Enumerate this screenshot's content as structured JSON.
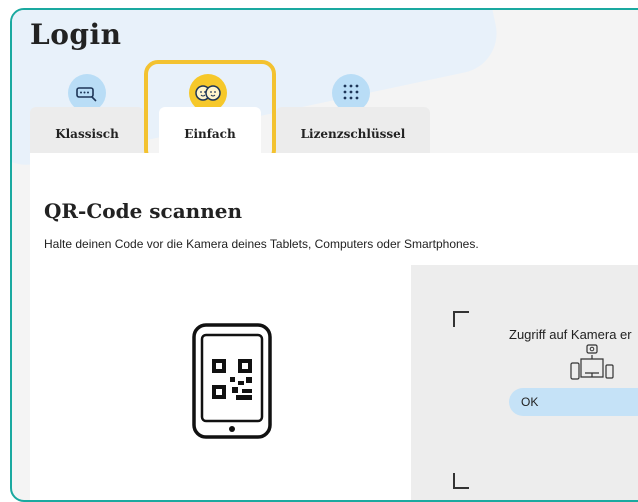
{
  "page": {
    "title": "Login"
  },
  "tabs": [
    {
      "label": "Klassisch",
      "icon": "key-icon",
      "active": false
    },
    {
      "label": "Einfach",
      "icon": "children-faces-icon",
      "active": true
    },
    {
      "label": "Lizenzschlüssel",
      "icon": "keypad-icon",
      "active": false
    }
  ],
  "qr": {
    "heading": "QR-Code scannen",
    "description": "Halte deinen Code vor die Kamera deines Tablets, Computers oder Smartphones.",
    "illustration": "tablet-qr-icon"
  },
  "camera": {
    "message": "Zugriff auf Kamera er",
    "icon": "devices-camera-icon",
    "ok_label": "OK"
  },
  "colors": {
    "accent_frame": "#1aa9a0",
    "highlight": "#f3c230",
    "icon_blue": "#b9ddf6",
    "icon_yellow": "#f6c82a",
    "button_blue": "#c5e2f7"
  }
}
